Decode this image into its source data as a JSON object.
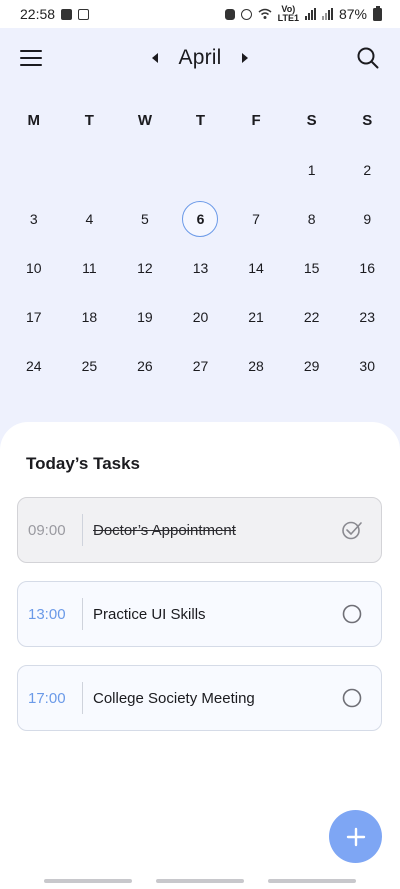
{
  "status_bar": {
    "time": "22:58",
    "battery": "87%",
    "net_top": "Vo)",
    "net_bottom": "LTE1"
  },
  "header": {
    "month": "April"
  },
  "calendar": {
    "weekdays": [
      "M",
      "T",
      "W",
      "T",
      "F",
      "S",
      "S"
    ],
    "weeks": [
      [
        "",
        "",
        "",
        "",
        "",
        "1",
        "2"
      ],
      [
        "3",
        "4",
        "5",
        "6",
        "7",
        "8",
        "9"
      ],
      [
        "10",
        "11",
        "12",
        "13",
        "14",
        "15",
        "16"
      ],
      [
        "17",
        "18",
        "19",
        "20",
        "21",
        "22",
        "23"
      ],
      [
        "24",
        "25",
        "26",
        "27",
        "28",
        "29",
        "30"
      ]
    ],
    "today": "6"
  },
  "tasks_section": {
    "title": "Today’s Tasks",
    "tasks": [
      {
        "time": "09:00",
        "title": "Doctor’s Appointment",
        "done": true
      },
      {
        "time": "13:00",
        "title": "Practice UI Skills",
        "done": false
      },
      {
        "time": "17:00",
        "title": "College Society Meeting",
        "done": false
      }
    ]
  },
  "colors": {
    "accent": "#6b9ae8",
    "fab": "#7ea6f4",
    "calendar_bg": "#eef1fd"
  }
}
